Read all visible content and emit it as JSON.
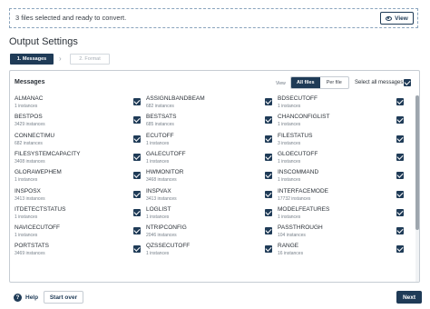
{
  "banner": {
    "text": "3 files selected and ready to convert.",
    "view_label": "View",
    "view_icon": "eye-icon"
  },
  "title": "Output Settings",
  "steps": [
    {
      "label": "1. Messages",
      "active": true
    },
    {
      "label": "2. Format",
      "active": false
    }
  ],
  "messages": {
    "title": "Messages",
    "view_label": "View",
    "toggle": {
      "all": "All files",
      "per": "Per file",
      "selected": "All files"
    },
    "select_all_label": "Select all messages",
    "select_all_checked": true,
    "items": [
      {
        "name": "ALMANAC",
        "count": "1 instances",
        "checked": true
      },
      {
        "name": "ASSIGNLBANDBEAM",
        "count": "682 instances",
        "checked": true
      },
      {
        "name": "BDSECUTOFF",
        "count": "1 instances",
        "checked": true
      },
      {
        "name": "BESTPOS",
        "count": "3429 instances",
        "checked": true
      },
      {
        "name": "BESTSATS",
        "count": "685 instances",
        "checked": true
      },
      {
        "name": "CHANCONFIGLIST",
        "count": "1 instances",
        "checked": true
      },
      {
        "name": "CONNECTIMU",
        "count": "682 instances",
        "checked": true
      },
      {
        "name": "ECUTOFF",
        "count": "1 instances",
        "checked": true
      },
      {
        "name": "FILESTATUS",
        "count": "3 instances",
        "checked": true
      },
      {
        "name": "FILESYSTEMCAPACITY",
        "count": "3408 instances",
        "checked": true
      },
      {
        "name": "GALECUTOFF",
        "count": "1 instances",
        "checked": true
      },
      {
        "name": "GLOECUTOFF",
        "count": "1 instances",
        "checked": true
      },
      {
        "name": "GLORAWEPHEM",
        "count": "1 instances",
        "checked": true
      },
      {
        "name": "HWMONITOR",
        "count": "3468 instances",
        "checked": true
      },
      {
        "name": "INSCOMMAND",
        "count": "1 instances",
        "checked": true
      },
      {
        "name": "INSPOSX",
        "count": "3413 instances",
        "checked": true
      },
      {
        "name": "INSPVAX",
        "count": "3413 instances",
        "checked": true
      },
      {
        "name": "INTERFACEMODE",
        "count": "17732 instances",
        "checked": true
      },
      {
        "name": "ITDETECTSTATUS",
        "count": "1 instances",
        "checked": true
      },
      {
        "name": "LOGLIST",
        "count": "1 instances",
        "checked": true
      },
      {
        "name": "MODELFEATURES",
        "count": "1 instances",
        "checked": true
      },
      {
        "name": "NAVICECUTOFF",
        "count": "1 instances",
        "checked": true
      },
      {
        "name": "NTRIPCONFIG",
        "count": "2046 instances",
        "checked": true
      },
      {
        "name": "PASSTHROUGH",
        "count": "104 instances",
        "checked": true
      },
      {
        "name": "PORTSTATS",
        "count": "3469 instances",
        "checked": true
      },
      {
        "name": "QZSSECUTOFF",
        "count": "1 instances",
        "checked": true
      },
      {
        "name": "RANGE",
        "count": "16 instances",
        "checked": true
      }
    ]
  },
  "footer": {
    "help": "Help",
    "start_over": "Start over",
    "next": "Next"
  },
  "colors": {
    "primary": "#1f3b57",
    "border": "#c6ccd3"
  }
}
